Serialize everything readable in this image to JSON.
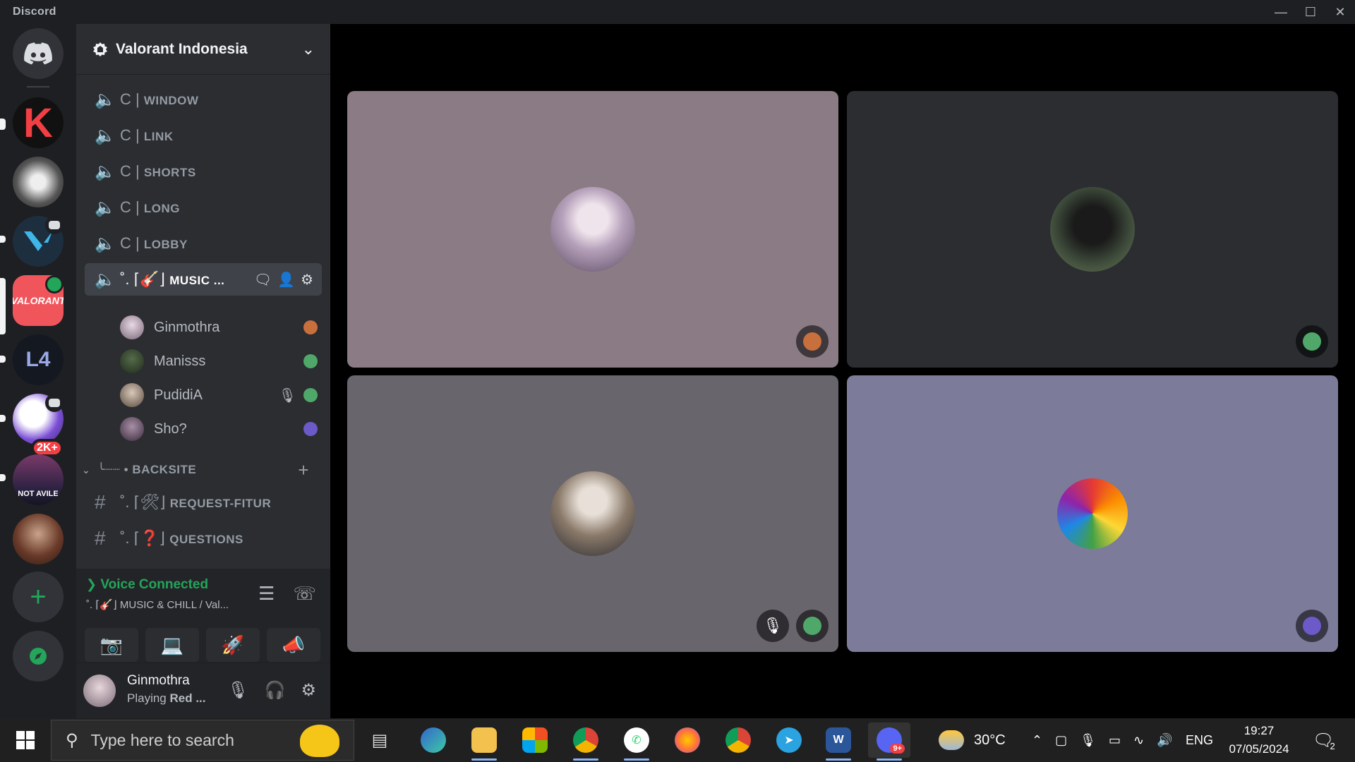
{
  "window": {
    "title": "Discord"
  },
  "guild": {
    "name": "Valorant Indonesia"
  },
  "channels": [
    {
      "prefix": "C |",
      "name": "WINDOW"
    },
    {
      "prefix": "C |",
      "name": "LINK"
    },
    {
      "prefix": "C |",
      "name": "SHORTS"
    },
    {
      "prefix": "C |",
      "name": "LONG"
    },
    {
      "prefix": "C |",
      "name": "LOBBY"
    }
  ],
  "active_channel": {
    "prefix": "˚. ⌈🎸⌋",
    "name": "MUSIC ..."
  },
  "voice_users": [
    {
      "name": "Ginmothra",
      "activity_color": "#c86f3e"
    },
    {
      "name": "Manisss",
      "activity_color": "#4fa86a"
    },
    {
      "name": "PudidiA",
      "activity_color": "#4fa86a",
      "muted": true
    },
    {
      "name": "Sho?",
      "activity_color": "#6b5ac8"
    }
  ],
  "category": {
    "name": "╰┈┈ • BACKSITE"
  },
  "text_channels": [
    {
      "prefix": "˚. ⌈🛠⌋",
      "name": "REQUEST-FITUR"
    },
    {
      "prefix": "˚. ⌈❓⌋",
      "name": "QUESTIONS"
    }
  ],
  "voice_panel": {
    "status": "Voice Connected",
    "channel": "˚. ⌈🎸⌋ MUSIC & CHILL / Val..."
  },
  "user_panel": {
    "name": "Ginmothra",
    "status_prefix": "Playing",
    "status_game": "Red ..."
  },
  "servers": [
    {
      "name": "K",
      "badge": ""
    },
    {
      "name": "manga",
      "badge": ""
    },
    {
      "name": "valorant-blue",
      "badge": ""
    },
    {
      "name": "VALORANT",
      "badge": ""
    },
    {
      "name": "Lost Archive",
      "badge": ""
    },
    {
      "name": "purple",
      "badge": "2K+"
    },
    {
      "name": "NOT AVILE",
      "badge": ""
    },
    {
      "name": "photo",
      "badge": ""
    }
  ],
  "tiles": [
    {
      "bg": "#8a7b84",
      "avatar": "#d9c8d6",
      "badge_color": "#c86f3e",
      "muted": false
    },
    {
      "bg": "#2b2d31",
      "avatar": "#3d4a3a",
      "badge_color": "#4fa86a",
      "muted": false
    },
    {
      "bg": "#69656d",
      "avatar": "#b8a89a",
      "badge_color": "#4fa86a",
      "muted": true
    },
    {
      "bg": "#7c7b9a",
      "avatar": "#e0477a",
      "badge_color": "#6b5ac8",
      "muted": false
    }
  ],
  "taskbar": {
    "search_placeholder": "Type here to search",
    "weather": "30°C",
    "lang": "ENG",
    "time": "19:27",
    "date": "07/05/2024",
    "notifications": "2",
    "discord_badge": "9+"
  },
  "colors": {
    "accent_green": "#23a55a",
    "danger": "#f23f43"
  }
}
